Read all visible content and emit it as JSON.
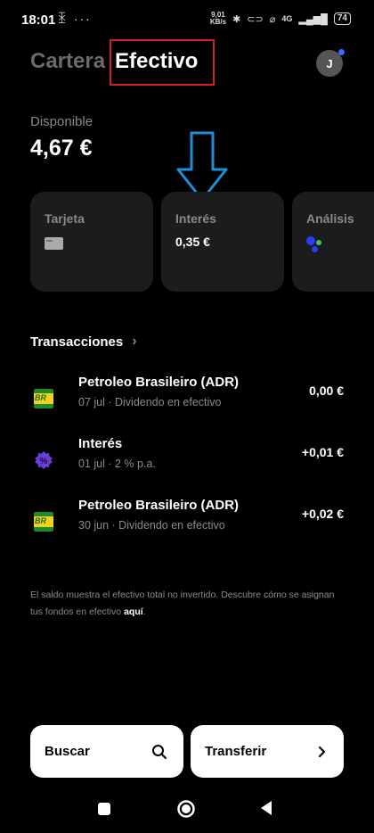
{
  "status_bar": {
    "time": "18:01",
    "left_icons": "ꀫ ···",
    "speed_top": "9,01",
    "speed_unit": "KB/s",
    "network": "4G",
    "battery": "74",
    "icons": [
      "people-icon",
      "more-dots-icon",
      "bluetooth-icon",
      "link-icon",
      "wifi-off-icon",
      "signal-icon",
      "battery-icon"
    ]
  },
  "header": {
    "tab_cartera": "Cartera",
    "tab_efectivo": "Efectivo",
    "avatar_initial": "J"
  },
  "balance": {
    "label": "Disponible",
    "value": "4,67 €"
  },
  "cards": [
    {
      "title": "Tarjeta",
      "icon": "card-icon"
    },
    {
      "title": "Interés",
      "value": "0,35 €"
    },
    {
      "title": "Análisis",
      "icon": "analysis-dots-icon"
    }
  ],
  "transactions": {
    "header": "Transacciones",
    "items": [
      {
        "title": "Petroleo Brasileiro (ADR)",
        "subtitle": "07 jul · Dividendo en efectivo",
        "amount": "0,00 €",
        "icon": "petrobras-logo",
        "logo_text": "BR"
      },
      {
        "title": "Interés",
        "subtitle": "01 jul · 2 % p.a.",
        "amount": "+0,01 €",
        "icon": "percent-badge-icon"
      },
      {
        "title": "Petroleo Brasileiro (ADR)",
        "subtitle": "30 jun · Dividendo en efectivo",
        "amount": "+0,02 €",
        "icon": "petrobras-logo",
        "logo_text": "BR"
      }
    ]
  },
  "footnote": {
    "text": "El saldo muestra el efectivo total no invertido. Descubre cómo se asignan tus fondos en efectivo ",
    "link": "aquí",
    "end": "."
  },
  "actions": {
    "search_label": "Buscar",
    "transfer_label": "Transferir"
  },
  "colors": {
    "background": "#000000",
    "card_bg": "#1c1c1e",
    "highlight_box": "#d21f2b",
    "annotation_arrow": "#1e90d6",
    "muted_text": "#8a8a8a"
  }
}
